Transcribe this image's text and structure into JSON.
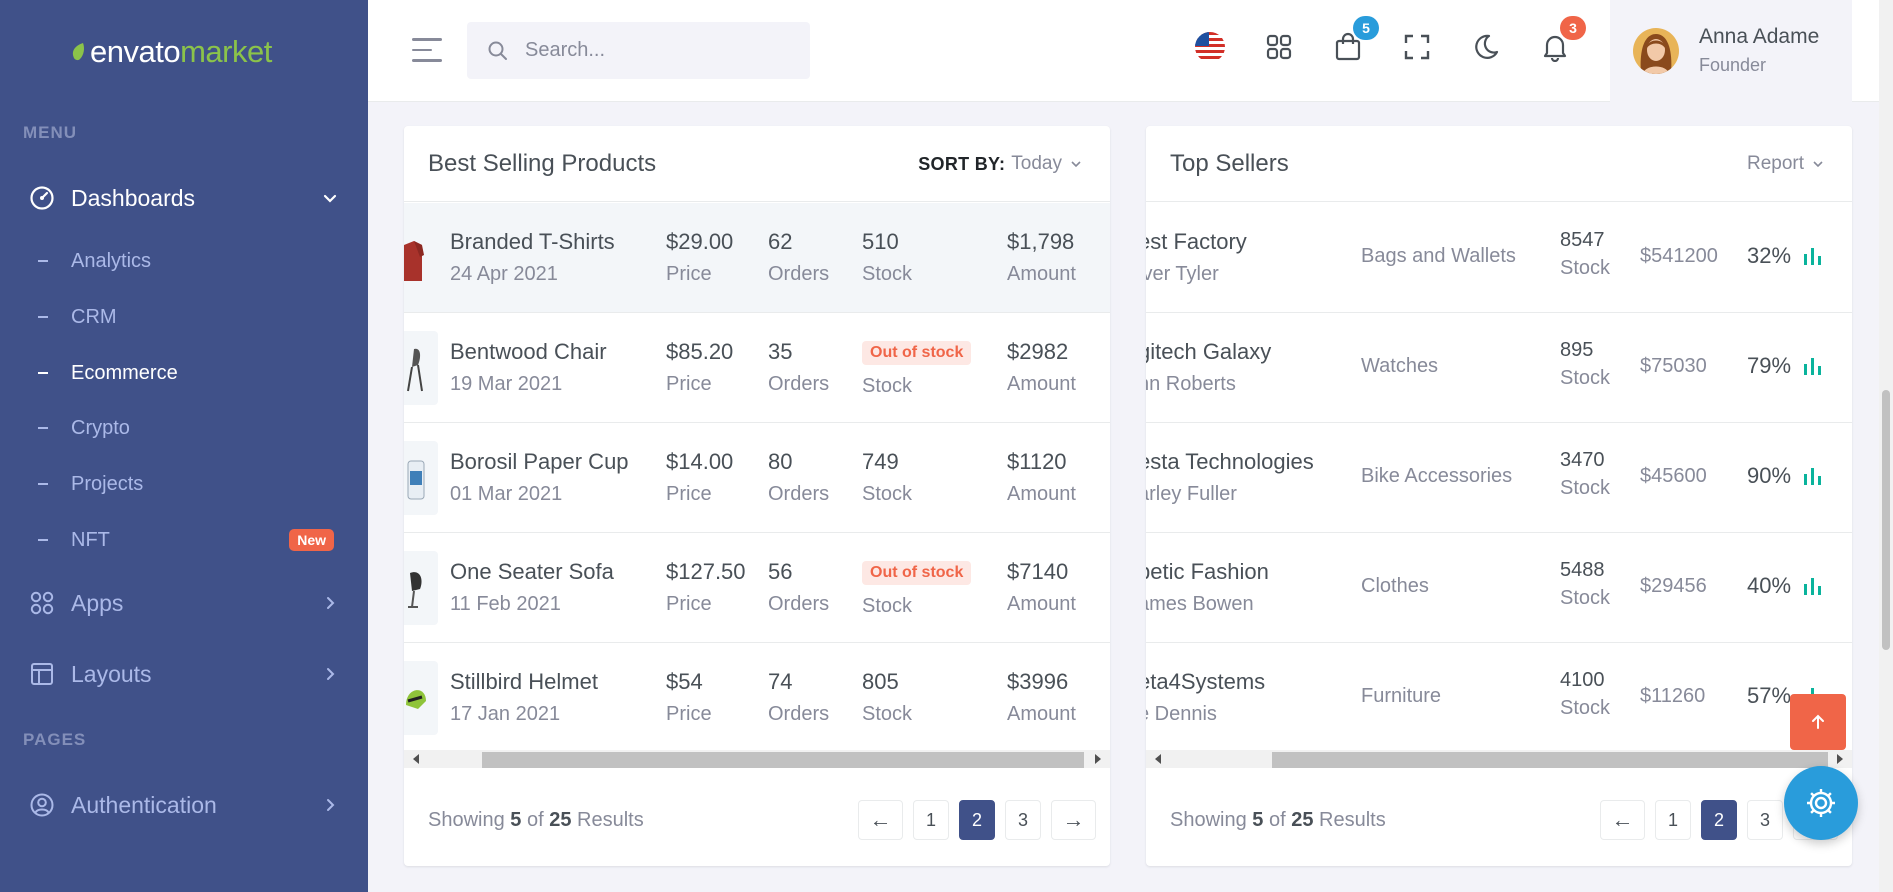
{
  "brand": {
    "word1": "envato",
    "word2": "market"
  },
  "sidebar": {
    "menu_title": "MENU",
    "pages_title": "PAGES",
    "dashboards": "Dashboards",
    "sub_items": [
      "Analytics",
      "CRM",
      "Ecommerce",
      "Crypto",
      "Projects",
      "NFT"
    ],
    "active_sub": "Ecommerce",
    "new_badge": "New",
    "apps": "Apps",
    "layouts": "Layouts",
    "authentication": "Authentication"
  },
  "topbar": {
    "search_placeholder": "Search...",
    "cart_count": "5",
    "notif_count": "3",
    "user_name": "Anna Adame",
    "user_role": "Founder"
  },
  "best_selling": {
    "title": "Best Selling Products",
    "sort_label": "SORT BY:",
    "sort_value": "Today",
    "rows": [
      {
        "name": "Branded T-Shirts",
        "date": "24 Apr 2021",
        "price": "$29.00",
        "orders": "62",
        "stock": "510",
        "amount": "$1,798",
        "out": false
      },
      {
        "name": "Bentwood Chair",
        "date": "19 Mar 2021",
        "price": "$85.20",
        "orders": "35",
        "stock": "Out of stock",
        "amount": "$2982",
        "out": true
      },
      {
        "name": "Borosil Paper Cup",
        "date": "01 Mar 2021",
        "price": "$14.00",
        "orders": "80",
        "stock": "749",
        "amount": "$1120",
        "out": false
      },
      {
        "name": "One Seater Sofa",
        "date": "11 Feb 2021",
        "price": "$127.50",
        "orders": "56",
        "stock": "Out of stock",
        "amount": "$7140",
        "out": true
      },
      {
        "name": "Stillbird Helmet",
        "date": "17 Jan 2021",
        "price": "$54",
        "orders": "74",
        "stock": "805",
        "amount": "$3996",
        "out": false
      }
    ],
    "labels": {
      "price": "Price",
      "orders": "Orders",
      "stock": "Stock",
      "amount": "Amount"
    },
    "footer": {
      "prefix": "Showing",
      "shown": "5",
      "of": "of",
      "total": "25",
      "suffix": "Results"
    },
    "pages": [
      "1",
      "2",
      "3"
    ],
    "active_page": "2"
  },
  "top_sellers": {
    "title": "Top Sellers",
    "report_label": "Report",
    "rows": [
      {
        "name": "est Factory",
        "person": "iver Tyler",
        "category": "Bags and Wallets",
        "stock": "8547",
        "amount": "$541200",
        "pct": "32%"
      },
      {
        "name": "gitech Galaxy",
        "person": "hn Roberts",
        "category": "Watches",
        "stock": "895",
        "amount": "$75030",
        "pct": "79%"
      },
      {
        "name": "esta Technologies",
        "person": "arley Fuller",
        "category": "Bike Accessories",
        "stock": "3470",
        "amount": "$45600",
        "pct": "90%"
      },
      {
        "name": "petic Fashion",
        "person": "ames Bowen",
        "category": "Clothes",
        "stock": "5488",
        "amount": "$29456",
        "pct": "40%"
      },
      {
        "name": "eta4Systems",
        "person": "e Dennis",
        "category": "Furniture",
        "stock": "4100",
        "amount": "$11260",
        "pct": "57%"
      }
    ],
    "stock_label": "Stock",
    "footer": {
      "prefix": "Showing",
      "shown": "5",
      "of": "of",
      "total": "25",
      "suffix": "Results"
    },
    "pages": [
      "1",
      "2",
      "3"
    ],
    "active_page": "2"
  },
  "colors": {
    "sidebar": "#405189",
    "accent": "#405189",
    "danger": "#f06548",
    "info": "#299cdb",
    "success": "#0ab39c"
  },
  "pager_prev": "←",
  "pager_next": "→"
}
